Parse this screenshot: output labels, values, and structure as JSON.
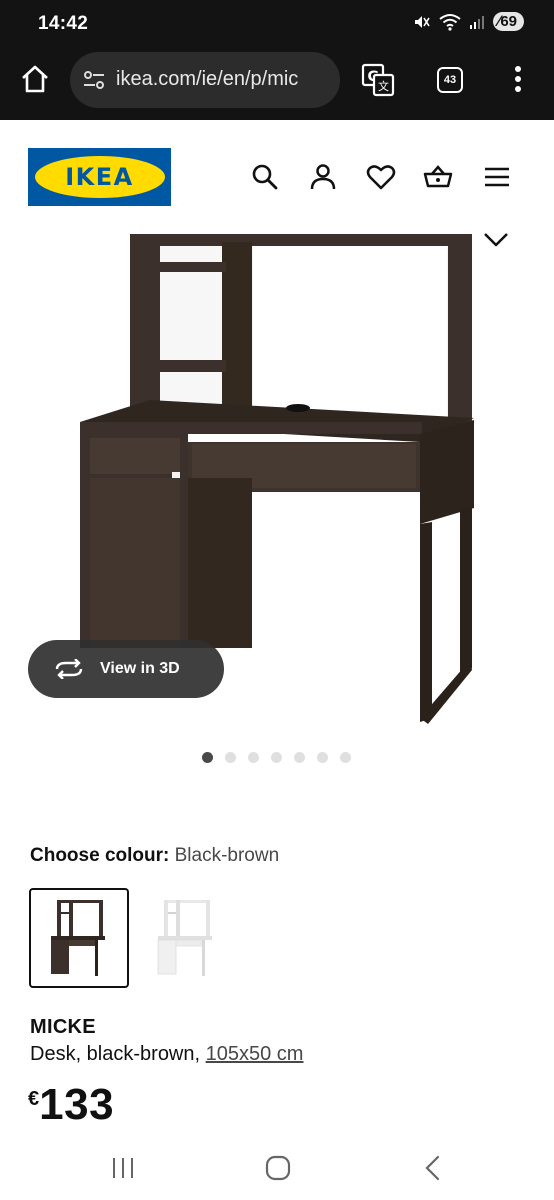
{
  "status_bar": {
    "time": "14:42",
    "battery": "69"
  },
  "browser": {
    "url": "ikea.com/ie/en/p/mic",
    "tab_count": "43"
  },
  "site": {
    "logo_text": "IKEA"
  },
  "product_image": {
    "view_3d_label": "View in 3D",
    "image_count": 7,
    "active_image": 1
  },
  "colour": {
    "label": "Choose colour:",
    "value": "Black-brown"
  },
  "product": {
    "name": "MICKE",
    "description": "Desk, black-brown, ",
    "dimensions": "105x50 cm",
    "currency": "€",
    "price": "133"
  },
  "colors": {
    "ikea_blue": "#0058a3",
    "ikea_yellow": "#ffdb00",
    "desk_dark": "#3b302b",
    "status_bg": "#131313"
  },
  "icons": [
    "home-icon",
    "tune-icon",
    "translate-icon",
    "tabs-icon",
    "more-vert-icon",
    "search-icon",
    "account-icon",
    "heart-icon",
    "basket-icon",
    "hamburger-icon",
    "rotate-icon",
    "recents-icon",
    "home-nav-icon",
    "back-icon"
  ]
}
